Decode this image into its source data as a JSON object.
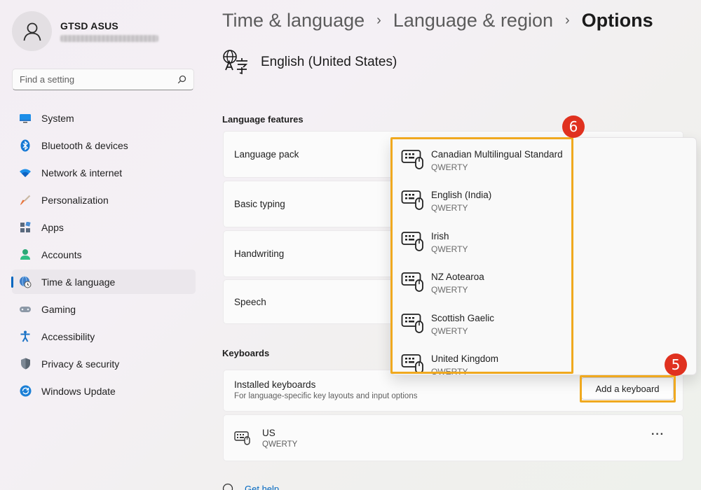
{
  "profile": {
    "name": "GTSD ASUS"
  },
  "search": {
    "placeholder": "Find a setting"
  },
  "nav": {
    "items": [
      {
        "label": "System",
        "icon": "monitor-icon"
      },
      {
        "label": "Bluetooth & devices",
        "icon": "bluetooth-icon"
      },
      {
        "label": "Network & internet",
        "icon": "wifi-icon"
      },
      {
        "label": "Personalization",
        "icon": "brush-icon"
      },
      {
        "label": "Apps",
        "icon": "apps-icon"
      },
      {
        "label": "Accounts",
        "icon": "person-icon"
      },
      {
        "label": "Time & language",
        "icon": "globe-clock-icon",
        "active": true
      },
      {
        "label": "Gaming",
        "icon": "gamepad-icon"
      },
      {
        "label": "Accessibility",
        "icon": "accessibility-icon"
      },
      {
        "label": "Privacy & security",
        "icon": "shield-icon"
      },
      {
        "label": "Windows Update",
        "icon": "update-icon"
      }
    ]
  },
  "breadcrumb": {
    "level1": "Time & language",
    "level2": "Language & region",
    "current": "Options",
    "separator": "›"
  },
  "language": {
    "title": "English (United States)"
  },
  "features": {
    "label": "Language features",
    "items": [
      "Language pack",
      "Basic typing",
      "Handwriting",
      "Speech"
    ]
  },
  "keyboards": {
    "label": "Keyboards",
    "installed_title": "Installed keyboards",
    "installed_sub": "For language-specific key layouts and input options",
    "add_label": "Add a keyboard",
    "entry": {
      "name": "US",
      "layout": "QWERTY",
      "more": "···"
    }
  },
  "dropdown": {
    "items": [
      {
        "name": "Canadian Multilingual Standard",
        "layout": "QWERTY"
      },
      {
        "name": "English (India)",
        "layout": "QWERTY"
      },
      {
        "name": "Irish",
        "layout": "QWERTY"
      },
      {
        "name": "NZ Aotearoa",
        "layout": "QWERTY"
      },
      {
        "name": "Scottish Gaelic",
        "layout": "QWERTY"
      },
      {
        "name": "United Kingdom",
        "layout": "QWERTY"
      }
    ]
  },
  "help": {
    "label": "Get help"
  },
  "annotations": {
    "step_add": "5",
    "step_list": "6",
    "highlight_color": "#f0a91f",
    "badge_color": "#e0311f"
  },
  "colors": {
    "accent": "#0067c0"
  }
}
